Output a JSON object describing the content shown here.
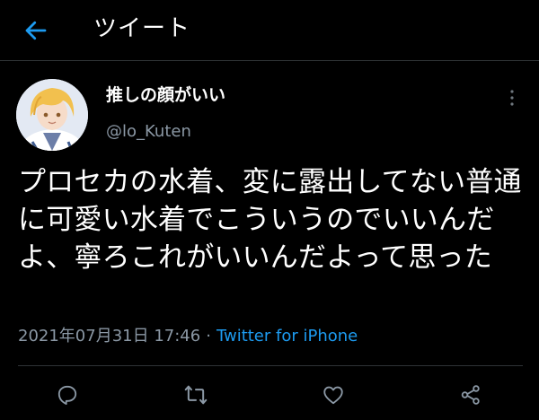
{
  "header": {
    "title": "ツイート",
    "back_icon": "arrow-left-icon"
  },
  "colors": {
    "background": "#000000",
    "accent": "#1d9bf0",
    "secondary_text": "#8b98a5",
    "divider": "#2f3336"
  },
  "tweet": {
    "display_name": "推しの顔がいい",
    "username": "@lo_Kuten",
    "text": "プロセカの水着、変に露出してない普通に可愛い水着でこういうのでいいんだよ、寧ろこれがいいんだよって思った",
    "timestamp": "2021年07月31日 17:46",
    "separator": "·",
    "source": "Twitter for iPhone"
  },
  "actions": [
    {
      "name": "reply",
      "icon": "reply-icon"
    },
    {
      "name": "retweet",
      "icon": "retweet-icon"
    },
    {
      "name": "like",
      "icon": "heart-icon"
    },
    {
      "name": "share",
      "icon": "share-icon"
    }
  ]
}
